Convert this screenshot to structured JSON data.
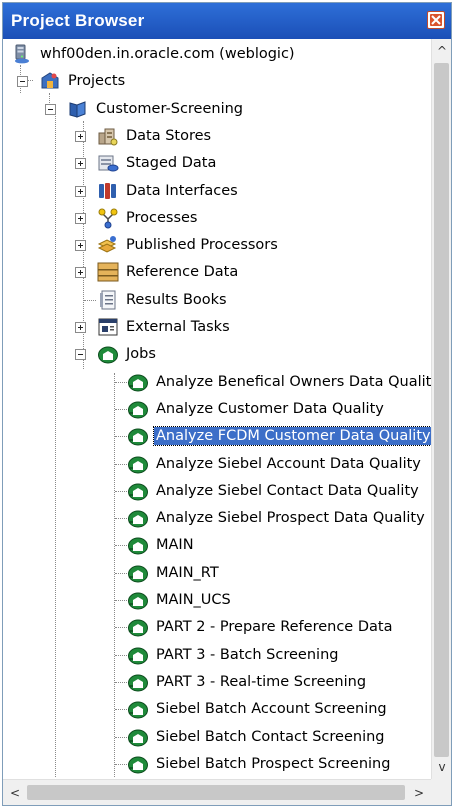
{
  "window": {
    "title": "Project Browser",
    "colors": {
      "titlebar": "#1b4fb7",
      "selection": "#3c6ec8",
      "close": "#d9532c"
    }
  },
  "tree": {
    "server": {
      "label": "whf00den.in.oracle.com (weblogic)",
      "icon": "server-icon"
    },
    "projects": {
      "label": "Projects",
      "icon": "projects-folder-icon"
    },
    "project": {
      "label": "Customer-Screening",
      "icon": "project-book-icon"
    },
    "folders": [
      {
        "label": "Data Stores",
        "icon": "data-stores-icon",
        "expandable": true
      },
      {
        "label": "Staged Data",
        "icon": "staged-data-icon",
        "expandable": true
      },
      {
        "label": "Data Interfaces",
        "icon": "data-interfaces-icon",
        "expandable": true
      },
      {
        "label": "Processes",
        "icon": "processes-icon",
        "expandable": true
      },
      {
        "label": "Published Processors",
        "icon": "published-processors-icon",
        "expandable": true
      },
      {
        "label": "Reference Data",
        "icon": "reference-data-icon",
        "expandable": true
      },
      {
        "label": "Results Books",
        "icon": "results-books-icon",
        "expandable": false
      },
      {
        "label": "External Tasks",
        "icon": "external-tasks-icon",
        "expandable": true
      }
    ],
    "jobs_folder": {
      "label": "Jobs",
      "icon": "jobs-folder-icon"
    },
    "jobs": [
      {
        "label": "Analyze Benefical Owners Data Qualit"
      },
      {
        "label": "Analyze Customer Data Quality"
      },
      {
        "label": "Analyze FCDM Customer Data Quality",
        "selected": true
      },
      {
        "label": "Analyze Siebel Account Data Quality"
      },
      {
        "label": "Analyze Siebel Contact Data Quality"
      },
      {
        "label": "Analyze Siebel Prospect Data Quality"
      },
      {
        "label": "MAIN"
      },
      {
        "label": "MAIN_RT"
      },
      {
        "label": "MAIN_UCS"
      },
      {
        "label": "PART 2 - Prepare Reference Data"
      },
      {
        "label": "PART 3 - Batch Screening"
      },
      {
        "label": "PART 3 - Real-time Screening"
      },
      {
        "label": "Siebel Batch Account Screening"
      },
      {
        "label": "Siebel Batch Contact Screening"
      },
      {
        "label": "Siebel Batch Prospect Screening"
      }
    ]
  },
  "scrollbars": {
    "up_arrow": "^",
    "down_arrow": "v",
    "left_arrow": "<",
    "right_arrow": ">"
  }
}
